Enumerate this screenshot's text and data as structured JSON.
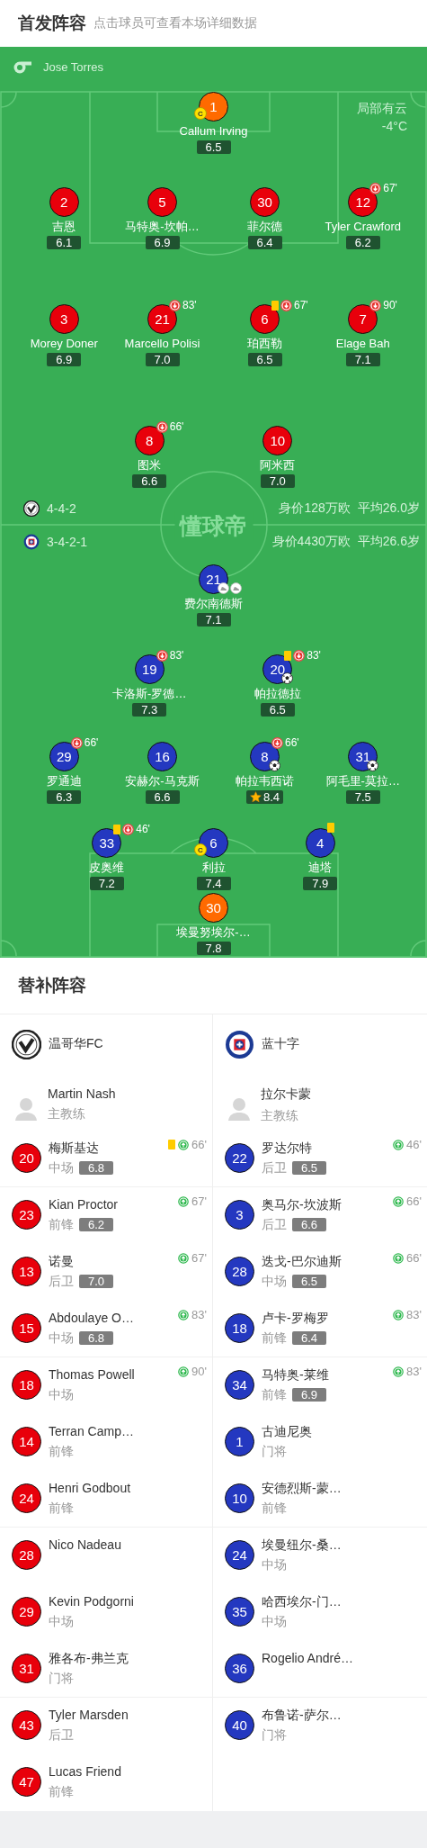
{
  "header": {
    "title": "首发阵容",
    "subtitle": "点击球员可查看本场详细数据"
  },
  "pitch": {
    "coach": "Jose Torres",
    "weather": "局部有云",
    "temperature": "-4°C",
    "center_mark": "懂球帝",
    "home": {
      "formation": "4-4-2",
      "value": "身价128万欧",
      "avg_age": "平均26.0岁",
      "color": "#e8000b",
      "lines": [
        {
          "players": [
            {
              "kind": "goalkeeper",
              "number": "1",
              "name": "Callum Irving",
              "rating": "6.5",
              "captain": "C",
              "yellow_card": false,
              "mvp": false
            }
          ]
        },
        {
          "players": [
            {
              "kind": "outfield",
              "number": "2",
              "name": "吉恩",
              "rating": "6.1",
              "yellow_card": false,
              "mvp": false
            },
            {
              "kind": "outfield",
              "number": "5",
              "name": "马特奥-坎帕…",
              "rating": "6.9",
              "yellow_card": false,
              "mvp": false
            },
            {
              "kind": "outfield",
              "number": "30",
              "name": "菲尔德",
              "rating": "6.4",
              "yellow_card": false,
              "mvp": false
            },
            {
              "kind": "outfield",
              "number": "12",
              "name": "Tyler Crawford",
              "rating": "6.2",
              "yellow_card": false,
              "mvp": false,
              "sub_out": "67'"
            }
          ]
        },
        {
          "players": [
            {
              "kind": "outfield",
              "number": "3",
              "name": "Morey Doner",
              "rating": "6.9",
              "yellow_card": false,
              "mvp": false
            },
            {
              "kind": "outfield",
              "number": "21",
              "name": "Marcello Polisi",
              "rating": "7.0",
              "yellow_card": false,
              "mvp": false,
              "sub_out": "83'"
            },
            {
              "kind": "outfield",
              "number": "6",
              "name": "珀西勒",
              "rating": "6.5",
              "yellow_card": true,
              "mvp": false,
              "sub_out": "67'"
            },
            {
              "kind": "outfield",
              "number": "7",
              "name": "Elage Bah",
              "rating": "7.1",
              "yellow_card": false,
              "mvp": false,
              "sub_out": "90'"
            }
          ]
        },
        {
          "players": [
            {
              "kind": "outfield",
              "number": "8",
              "name": "图米",
              "rating": "6.6",
              "yellow_card": false,
              "mvp": false,
              "sub_out": "66'"
            },
            {
              "kind": "outfield",
              "number": "10",
              "name": "阿米西",
              "rating": "7.0",
              "yellow_card": false,
              "mvp": false
            }
          ]
        }
      ]
    },
    "away": {
      "formation": "3-4-2-1",
      "value": "身价4430万欧",
      "avg_age": "平均26.6岁",
      "color": "#2438c0",
      "lines": [
        {
          "players": [
            {
              "kind": "outfield",
              "number": "21",
              "name": "费尔南德斯",
              "rating": "7.1",
              "yellow_card": false,
              "mvp": false,
              "events": [
                {
                  "kind": "assist"
                },
                {
                  "kind": "assist"
                }
              ]
            }
          ]
        },
        {
          "players": [
            {
              "kind": "outfield",
              "number": "19",
              "name": "卡洛斯-罗德…",
              "rating": "7.3",
              "yellow_card": false,
              "mvp": false,
              "sub_out": "83'"
            },
            {
              "kind": "outfield",
              "number": "20",
              "name": "帕拉德拉",
              "rating": "6.5",
              "yellow_card": true,
              "mvp": false,
              "sub_out": "83'",
              "events": [
                {
                  "kind": "goal"
                }
              ]
            }
          ]
        },
        {
          "players": [
            {
              "kind": "outfield",
              "number": "29",
              "name": "罗通迪",
              "rating": "6.3",
              "yellow_card": false,
              "mvp": false,
              "sub_out": "66'"
            },
            {
              "kind": "outfield",
              "number": "16",
              "name": "安赫尔-马克斯",
              "rating": "6.6",
              "yellow_card": false,
              "mvp": false
            },
            {
              "kind": "outfield",
              "number": "8",
              "name": "帕拉韦西诺",
              "rating": "8.4",
              "yellow_card": false,
              "mvp": true,
              "sub_out": "66'",
              "events": [
                {
                  "kind": "goal"
                }
              ]
            },
            {
              "kind": "outfield",
              "number": "31",
              "name": "阿毛里-莫拉…",
              "rating": "7.5",
              "yellow_card": false,
              "mvp": false,
              "events": [
                {
                  "kind": "goal"
                }
              ]
            }
          ]
        },
        {
          "players": [
            {
              "kind": "outfield",
              "number": "33",
              "name": "皮奥维",
              "rating": "7.2",
              "yellow_card": true,
              "mvp": false,
              "sub_out": "46'"
            },
            {
              "kind": "outfield",
              "number": "6",
              "name": "利拉",
              "rating": "7.4",
              "captain": "C",
              "yellow_card": false,
              "mvp": false
            },
            {
              "kind": "outfield",
              "number": "4",
              "name": "迪塔",
              "rating": "7.9",
              "yellow_card": true,
              "mvp": false
            }
          ]
        },
        {
          "players": [
            {
              "kind": "goalkeeper",
              "number": "30",
              "name": "埃曼努埃尔-…",
              "rating": "7.8",
              "yellow_card": false,
              "mvp": false
            }
          ]
        }
      ]
    }
  },
  "subs": {
    "title": "替补阵容",
    "teams": [
      {
        "name": "温哥华FC",
        "color": "#e8000b",
        "coach": {
          "name": "Martin Nash",
          "role": "主教练"
        },
        "players": [
          {
            "number": "20",
            "name": "梅斯基达",
            "position": "中场",
            "rating": "6.8",
            "yellow_card": true,
            "sub_in": "66'"
          },
          {
            "number": "23",
            "name": "Kian Proctor",
            "position": "前锋",
            "rating": "6.2",
            "yellow_card": false,
            "sub_in": "67'"
          },
          {
            "number": "13",
            "name": "诺曼",
            "position": "后卫",
            "rating": "7.0",
            "yellow_card": false,
            "sub_in": "67'"
          },
          {
            "number": "15",
            "name": "Abdoulaye O…",
            "position": "中场",
            "rating": "6.8",
            "yellow_card": false,
            "sub_in": "83'"
          },
          {
            "number": "18",
            "name": "Thomas Powell",
            "position": "中场",
            "yellow_card": false,
            "sub_in": "90'"
          },
          {
            "number": "14",
            "name": "Terran Camp…",
            "position": "前锋",
            "yellow_card": false
          },
          {
            "number": "24",
            "name": "Henri Godbout",
            "position": "前锋",
            "yellow_card": false
          },
          {
            "number": "28",
            "name": "Nico Nadeau",
            "yellow_card": false
          },
          {
            "number": "29",
            "name": "Kevin Podgorni",
            "position": "中场",
            "yellow_card": false
          },
          {
            "number": "31",
            "name": "雅各布-弗兰克",
            "position": "门将",
            "yellow_card": false
          },
          {
            "number": "43",
            "name": "Tyler Marsden",
            "position": "后卫",
            "yellow_card": false
          },
          {
            "number": "47",
            "name": "Lucas Friend",
            "position": "前锋",
            "yellow_card": false
          }
        ]
      },
      {
        "name": "蓝十字",
        "color": "#2438c0",
        "coach": {
          "name": "拉尔卡蒙",
          "role": "主教练"
        },
        "players": [
          {
            "number": "22",
            "name": "罗达尔特",
            "position": "后卫",
            "rating": "6.5",
            "yellow_card": false,
            "sub_in": "46'"
          },
          {
            "number": "3",
            "name": "奥马尔-坎波斯",
            "position": "后卫",
            "rating": "6.6",
            "yellow_card": false,
            "sub_in": "66'"
          },
          {
            "number": "28",
            "name": "迭戈-巴尔迪斯",
            "position": "中场",
            "rating": "6.5",
            "yellow_card": false,
            "sub_in": "66'"
          },
          {
            "number": "18",
            "name": "卢卡-罗梅罗",
            "position": "前锋",
            "rating": "6.4",
            "yellow_card": false,
            "sub_in": "83'"
          },
          {
            "number": "34",
            "name": "马特奥-莱维",
            "position": "前锋",
            "rating": "6.9",
            "yellow_card": false,
            "sub_in": "83'"
          },
          {
            "number": "1",
            "name": "古迪尼奥",
            "position": "门将",
            "yellow_card": false
          },
          {
            "number": "10",
            "name": "安德烈斯-蒙…",
            "position": "前锋",
            "yellow_card": false
          },
          {
            "number": "24",
            "name": "埃曼纽尔-桑…",
            "position": "中场",
            "yellow_card": false
          },
          {
            "number": "35",
            "name": "哈西埃尔-门…",
            "position": "中场",
            "yellow_card": false
          },
          {
            "number": "36",
            "name": "Rogelio André…",
            "yellow_card": false
          },
          {
            "number": "40",
            "name": "布鲁诺-萨尔…",
            "position": "门将",
            "yellow_card": false
          }
        ]
      }
    ]
  }
}
